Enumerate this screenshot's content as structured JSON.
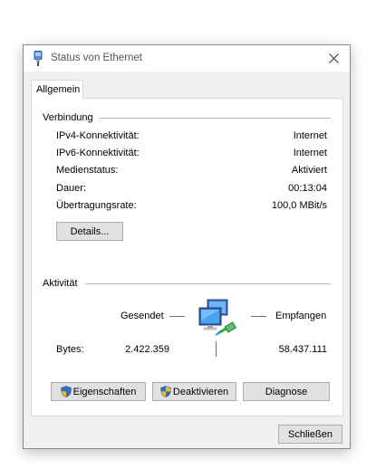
{
  "window": {
    "title": "Status von Ethernet",
    "close_icon": "close-icon"
  },
  "tabs": [
    {
      "label": "Allgemein",
      "selected": true
    }
  ],
  "connection": {
    "header": "Verbindung",
    "rows": [
      {
        "label": "IPv4-Konnektivität:",
        "value": "Internet"
      },
      {
        "label": "IPv6-Konnektivität:",
        "value": "Internet"
      },
      {
        "label": "Medienstatus:",
        "value": "Aktiviert"
      },
      {
        "label": "Dauer:",
        "value": "00:13:04"
      },
      {
        "label": "Übertragungsrate:",
        "value": "100,0 MBit/s"
      }
    ],
    "details_button": "Details..."
  },
  "activity": {
    "header": "Aktivität",
    "sent_label": "Gesendet",
    "received_label": "Empfangen",
    "bytes_label": "Bytes:",
    "bytes_sent": "2.422.359",
    "bytes_received": "58.437.111",
    "icon": "network-computers-icon"
  },
  "buttons": {
    "properties": "Eigenschaften",
    "disable": "Deaktivieren",
    "diagnose": "Diagnose",
    "close": "Schließen"
  },
  "colors": {
    "accent": "#0078d7",
    "window_bg": "#f0f0f0",
    "button_bg": "#e1e1e1"
  }
}
